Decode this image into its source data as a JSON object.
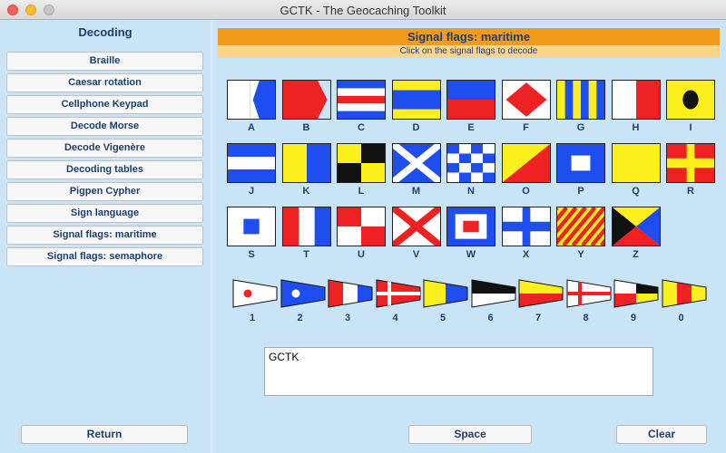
{
  "window": {
    "title": "GCTK - The Geocaching Toolkit"
  },
  "sidebar": {
    "heading": "Decoding",
    "items": [
      {
        "label": "Braille"
      },
      {
        "label": "Caesar rotation"
      },
      {
        "label": "Cellphone Keypad"
      },
      {
        "label": "Decode Morse"
      },
      {
        "label": "Decode Vigenère"
      },
      {
        "label": "Decoding tables"
      },
      {
        "label": "Pigpen Cypher"
      },
      {
        "label": "Sign language"
      },
      {
        "label": "Signal flags: maritime"
      },
      {
        "label": "Signal flags: semaphore"
      }
    ],
    "return_label": "Return"
  },
  "main": {
    "title": "Signal flags: maritime",
    "subtitle": "Click on the signal flags to decode",
    "letters": [
      "A",
      "B",
      "C",
      "D",
      "E",
      "F",
      "G",
      "H",
      "I",
      "J",
      "K",
      "L",
      "M",
      "N",
      "O",
      "P",
      "Q",
      "R",
      "S",
      "T",
      "U",
      "V",
      "W",
      "X",
      "Y",
      "Z"
    ],
    "digits": [
      "1",
      "2",
      "3",
      "4",
      "5",
      "6",
      "7",
      "8",
      "9",
      "0"
    ],
    "output_value": "GCTK",
    "space_label": "Space",
    "clear_label": "Clear"
  },
  "colors": {
    "flag_red": "#ee2222",
    "flag_blue": "#1f4ef0",
    "flag_yellow": "#fbf01c",
    "flag_black": "#111111",
    "flag_white": "#ffffff",
    "header_orange": "#f59b1c",
    "header_sub": "#fcd58d"
  }
}
